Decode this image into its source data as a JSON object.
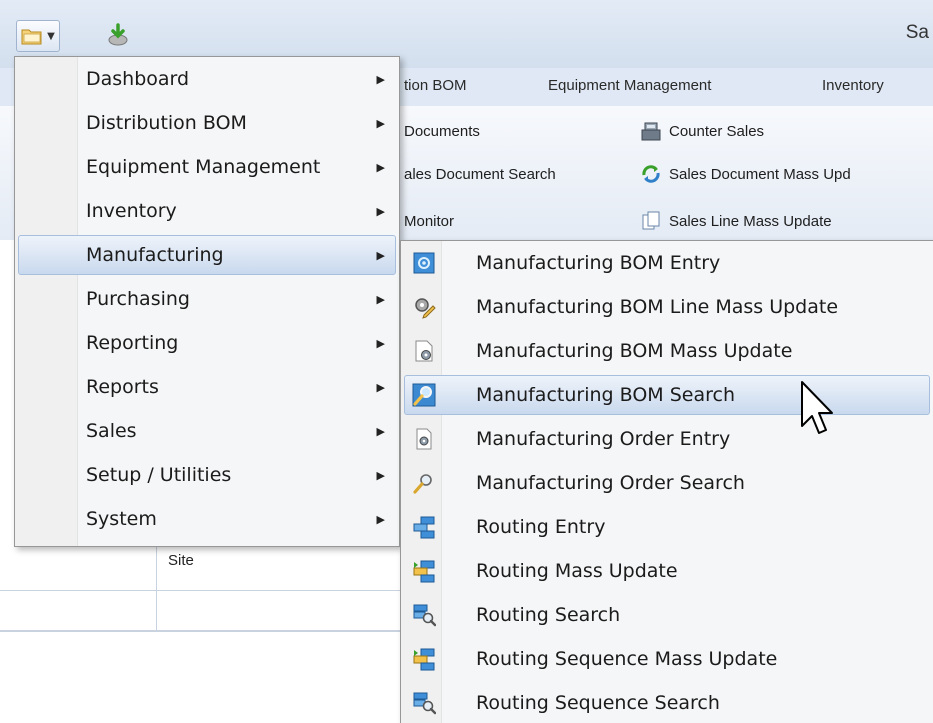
{
  "title_fragment": "Sa",
  "qat": {
    "main_icon": "folder-menu-icon",
    "refresh_icon": "refresh-download-icon"
  },
  "ribbon": {
    "tabs": [
      "tion BOM",
      "Equipment Management",
      "Inventory"
    ],
    "commands": [
      {
        "label": "Documents"
      },
      {
        "label": "Counter Sales",
        "icon": "cash-register-icon"
      },
      {
        "label": "ales Document Search"
      },
      {
        "label": "Sales Document Mass Upd",
        "icon": "green-arrows-icon"
      },
      {
        "label": "Monitor"
      },
      {
        "label": "Sales Line Mass Update",
        "icon": "copy-lines-icon"
      }
    ]
  },
  "grid": {
    "column_header": "Site"
  },
  "main_menu": {
    "items": [
      {
        "label": "Dashboard"
      },
      {
        "label": "Distribution BOM"
      },
      {
        "label": "Equipment Management"
      },
      {
        "label": "Inventory"
      },
      {
        "label": "Manufacturing",
        "active": true
      },
      {
        "label": "Purchasing"
      },
      {
        "label": "Reporting"
      },
      {
        "label": "Reports"
      },
      {
        "label": "Sales"
      },
      {
        "label": "Setup / Utilities"
      },
      {
        "label": "System"
      }
    ],
    "arrow_glyph": "▶"
  },
  "sub_menu": {
    "items": [
      {
        "label": "Manufacturing BOM Entry",
        "icon": "bom-entry-icon"
      },
      {
        "label": "Manufacturing BOM Line Mass Update",
        "icon": "gear-pencil-icon"
      },
      {
        "label": "Manufacturing BOM Mass Update",
        "icon": "document-gear-icon"
      },
      {
        "label": "Manufacturing BOM Search",
        "icon": "magnifier-icon",
        "active": true
      },
      {
        "label": "Manufacturing Order Entry",
        "icon": "order-gear-icon"
      },
      {
        "label": "Manufacturing Order Search",
        "icon": "order-search-icon"
      },
      {
        "label": "Routing Entry",
        "icon": "routing-icon"
      },
      {
        "label": "Routing Mass Update",
        "icon": "routing-update-icon"
      },
      {
        "label": "Routing Search",
        "icon": "routing-search-icon"
      },
      {
        "label": "Routing Sequence Mass Update",
        "icon": "routing-update-icon"
      },
      {
        "label": "Routing Sequence Search",
        "icon": "routing-search-icon"
      }
    ]
  },
  "colors": {
    "highlight_top": "#eef3fa",
    "highlight_bottom": "#c9d9ee",
    "highlight_border": "#a7bedd",
    "menu_bg": "#f5f6f7"
  }
}
